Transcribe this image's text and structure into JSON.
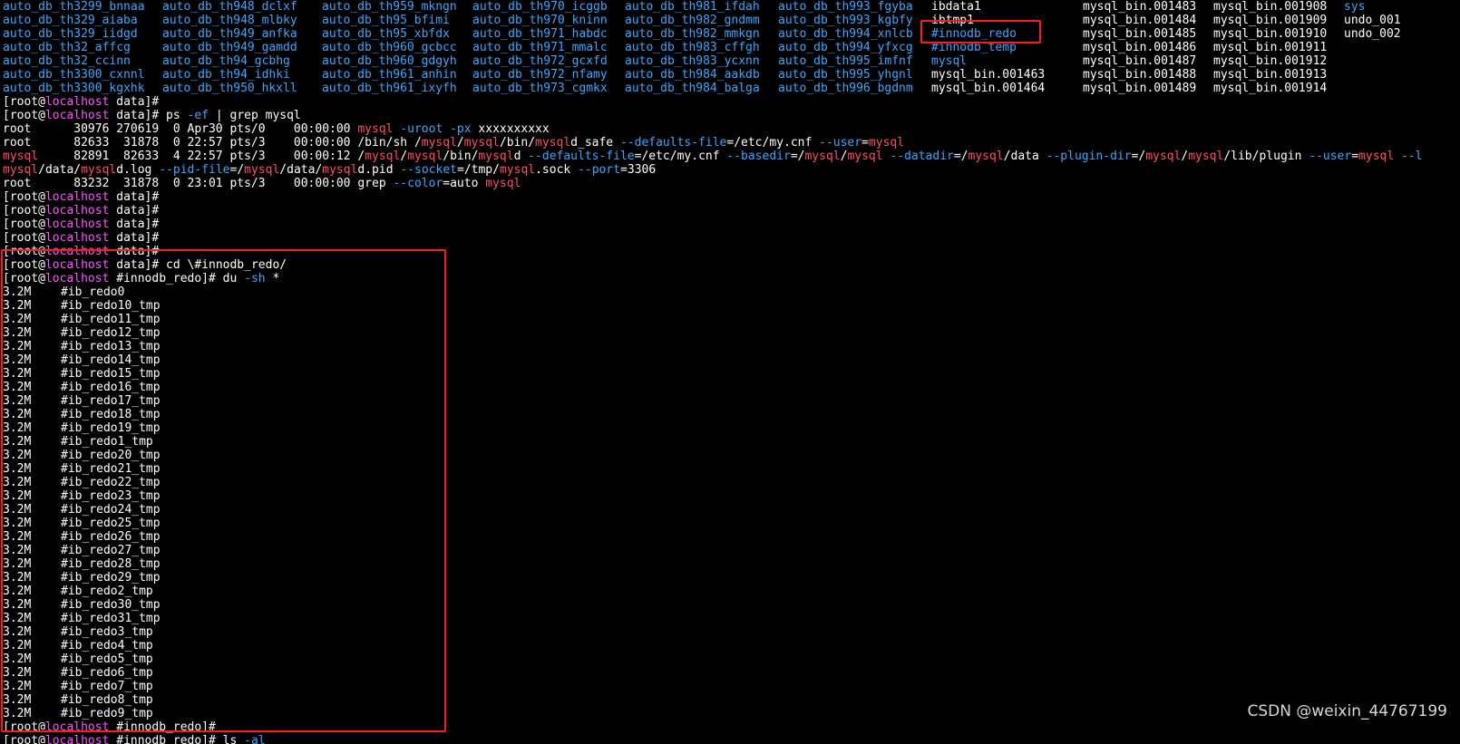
{
  "colors": {
    "background": "#000000",
    "directory": "#3aa7ff",
    "file": "#ffffff",
    "hostname": "#ff55ff",
    "grep_match": "#ff4b6e",
    "option": "#3aa7ff",
    "highlight_box": "#ff1a1a"
  },
  "listing": {
    "columns": [
      {
        "type": "dir",
        "items": [
          "auto_db_th3299_bnnaa",
          "auto_db_th329_aiaba",
          "auto_db_th329_iidgd",
          "auto_db_th32_affcg",
          "auto_db_th32_ccinn",
          "auto_db_th3300_cxnnl",
          "auto_db_th3300_kgxhk"
        ]
      },
      {
        "type": "dir",
        "items": [
          "auto_db_th948_dclxf",
          "auto_db_th948_mlbky",
          "auto_db_th949_anfka",
          "auto_db_th949_gamdd",
          "auto_db_th94_gcbhg",
          "auto_db_th94_idhki",
          "auto_db_th950_hkxll"
        ]
      },
      {
        "type": "dir",
        "items": [
          "auto_db_th959_mkngn",
          "auto_db_th95_bfimi",
          "auto_db_th95_xbfdx",
          "auto_db_th960_gcbcc",
          "auto_db_th960_gdgyh",
          "auto_db_th961_anhin",
          "auto_db_th961_ixyfh"
        ]
      },
      {
        "type": "dir",
        "items": [
          "auto_db_th970_icggb",
          "auto_db_th970_kninn",
          "auto_db_th971_habdc",
          "auto_db_th971_mmalc",
          "auto_db_th972_gcxfd",
          "auto_db_th972_nfamy",
          "auto_db_th973_cgmkx"
        ]
      },
      {
        "type": "dir",
        "items": [
          "auto_db_th981_ifdah",
          "auto_db_th982_gndmm",
          "auto_db_th982_mmkgn",
          "auto_db_th983_cffgh",
          "auto_db_th983_ycxnn",
          "auto_db_th984_aakdb",
          "auto_db_th984_balga"
        ]
      },
      {
        "type": "dir",
        "items": [
          "auto_db_th993_fgyba",
          "auto_db_th993_kgbfy",
          "auto_db_th994_xnlcb",
          "auto_db_th994_yfxcg",
          "auto_db_th995_imfnf",
          "auto_db_th995_yhgnl",
          "auto_db_th996_bgdnm"
        ]
      },
      {
        "type": "mixed",
        "items": [
          {
            "t": "ibdata1",
            "c": "file"
          },
          {
            "t": "ibtmp1",
            "c": "file"
          },
          {
            "t": "#innodb_redo",
            "c": "dir"
          },
          {
            "t": "#innodb_temp",
            "c": "dir"
          },
          {
            "t": "mysql",
            "c": "dir"
          },
          {
            "t": "mysql_bin.001463",
            "c": "file"
          },
          {
            "t": "mysql_bin.001464",
            "c": "file"
          }
        ]
      },
      {
        "type": "file",
        "items": [
          "mysql_bin.001483",
          "mysql_bin.001484",
          "mysql_bin.001485",
          "mysql_bin.001486",
          "mysql_bin.001487",
          "mysql_bin.001488",
          "mysql_bin.001489"
        ]
      },
      {
        "type": "file",
        "items": [
          "mysql_bin.001908",
          "mysql_bin.001909",
          "mysql_bin.001910",
          "mysql_bin.001911",
          "mysql_bin.001912",
          "mysql_bin.001913",
          "mysql_bin.001914"
        ]
      },
      {
        "type": "mixed",
        "items": [
          {
            "t": "sys",
            "c": "dir"
          },
          {
            "t": "undo_001",
            "c": "file"
          },
          {
            "t": "undo_002",
            "c": "file"
          }
        ]
      }
    ]
  },
  "prompt": {
    "open": "[root@",
    "host": "localhost",
    "dir_data": " data]",
    "dir_redo": " #innodb_redo]",
    "hash": "#"
  },
  "ps_command": {
    "prefix": " ps ",
    "flag": "-ef",
    "rest": " | grep mysql"
  },
  "ps_rows": {
    "r1": {
      "cols": "root      30976 270619  0 Apr30 pts/0    00:00:00 ",
      "mysql": "mysql",
      "sp1": " ",
      "opt1": "-uroot",
      "sp2": " ",
      "opt2": "-px",
      "tail": " xxxxxxxxxx"
    },
    "r2": {
      "cols": "root      82633  31878  0 22:57 pts/3    00:00:00 /bin/sh /",
      "m1": "mysql",
      "s1": "/",
      "m2": "mysql",
      "s2": "/bin/",
      "m3": "mysql",
      "s3": "d_safe ",
      "o1": "--defaults-file",
      "s4": "=/etc/my.cnf ",
      "o2": "--user",
      "s5": "=",
      "m4": "mysql"
    },
    "r3": {
      "user": "mysql",
      "cols": "     82891  82633  4 22:57 pts/3    00:00:12 /",
      "m1": "mysql",
      "s1": "/",
      "m2": "mysql",
      "s2": "/bin/",
      "m3": "mysql",
      "s3": "d ",
      "o1": "--defaults-file",
      "s4": "=/etc/my.cnf ",
      "o2": "--basedir",
      "s5": "=/",
      "m4": "mysql",
      "s6": "/",
      "m5": "mysql",
      "s7": " ",
      "o3": "--datadir",
      "s8": "=/",
      "m6": "mysql",
      "s9": "/data ",
      "o4": "--plugin-dir",
      "s10": "=/",
      "m7": "mysql",
      "s11": "/",
      "m8": "mysql",
      "s12": "/lib/plugin ",
      "o5": "--user",
      "s13": "=",
      "m9": "mysql",
      "s14": " ",
      "o6": "--l"
    },
    "r3b": {
      "m1": "mysql",
      "s1": "/data/",
      "m2": "mysql",
      "s2": "d.log ",
      "o1": "--pid-file",
      "s3": "=/",
      "m3": "mysql",
      "s4": "/data/",
      "m4": "mysql",
      "s5": "d.pid ",
      "o2": "--socket",
      "s6": "=/tmp/",
      "m5": "mysql",
      "s7": ".sock ",
      "o3": "--port",
      "s8": "=3306"
    },
    "r4": {
      "cols": "root      83232  31878  0 23:01 pts/3    00:00:00 grep ",
      "opt": "--color",
      "mid": "=auto ",
      "mysql": "mysql"
    }
  },
  "cd_command": " cd \\#innodb_redo/",
  "du_command": {
    "prefix": " du ",
    "flag": "-sh",
    "rest": " *"
  },
  "du_size": "3.2M",
  "du_files": [
    "#ib_redo0",
    "#ib_redo10_tmp",
    "#ib_redo11_tmp",
    "#ib_redo12_tmp",
    "#ib_redo13_tmp",
    "#ib_redo14_tmp",
    "#ib_redo15_tmp",
    "#ib_redo16_tmp",
    "#ib_redo17_tmp",
    "#ib_redo18_tmp",
    "#ib_redo19_tmp",
    "#ib_redo1_tmp",
    "#ib_redo20_tmp",
    "#ib_redo21_tmp",
    "#ib_redo22_tmp",
    "#ib_redo23_tmp",
    "#ib_redo24_tmp",
    "#ib_redo25_tmp",
    "#ib_redo26_tmp",
    "#ib_redo27_tmp",
    "#ib_redo28_tmp",
    "#ib_redo29_tmp",
    "#ib_redo2_tmp",
    "#ib_redo30_tmp",
    "#ib_redo31_tmp",
    "#ib_redo3_tmp",
    "#ib_redo4_tmp",
    "#ib_redo5_tmp",
    "#ib_redo6_tmp",
    "#ib_redo7_tmp",
    "#ib_redo8_tmp",
    "#ib_redo9_tmp"
  ],
  "ls_command": {
    "prefix": " ls ",
    "flag": "-al"
  },
  "watermark": "CSDN @weixin_44767199"
}
